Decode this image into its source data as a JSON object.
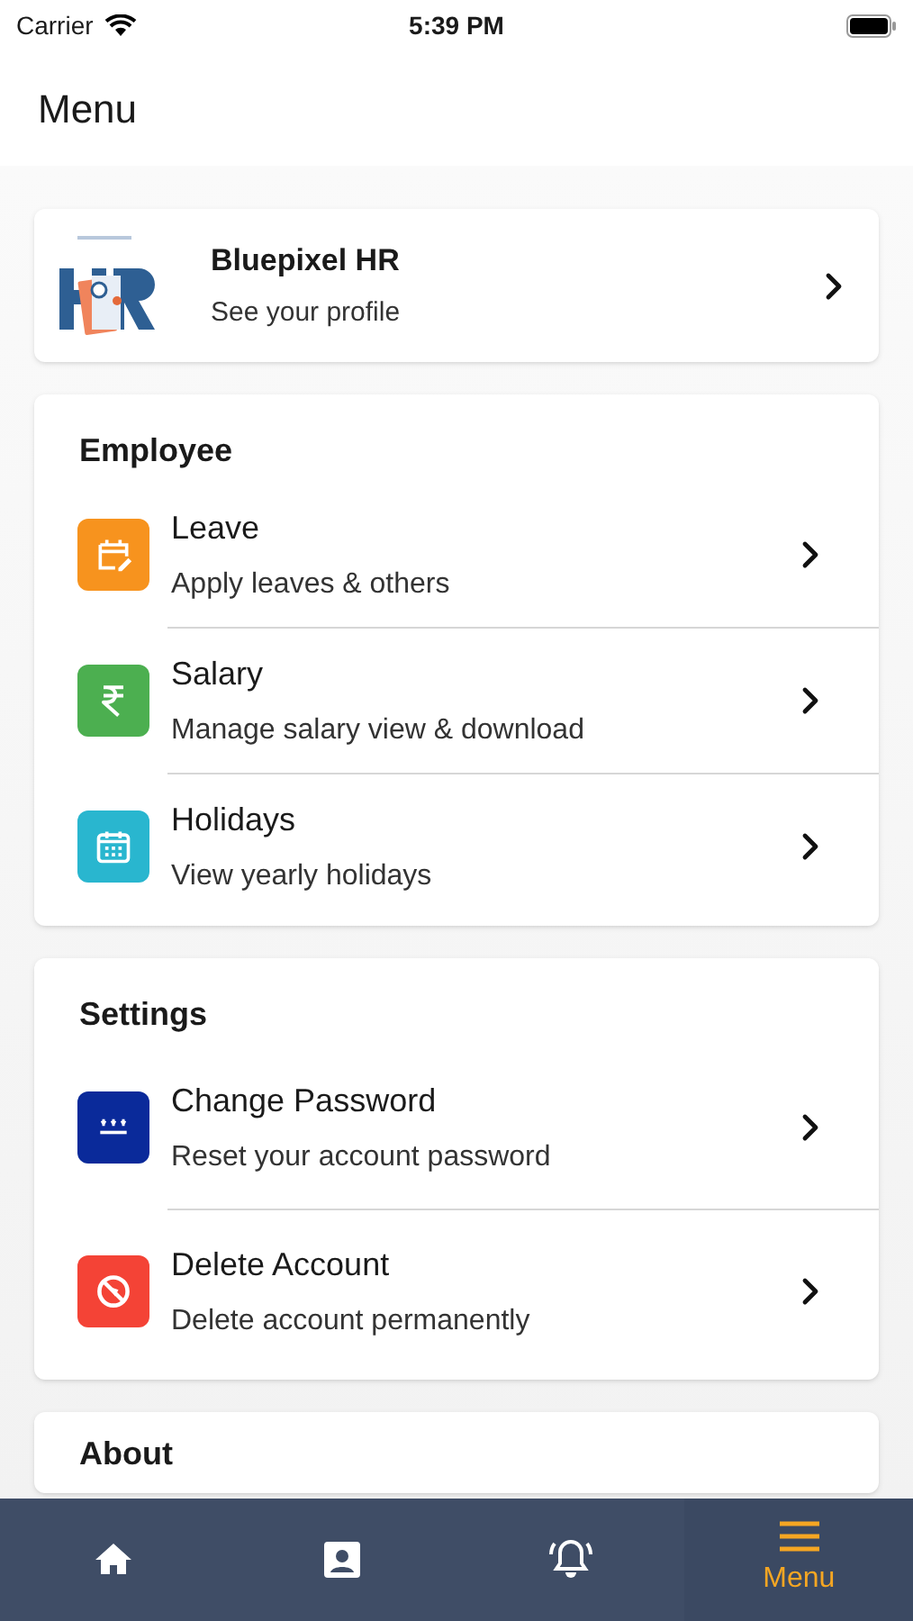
{
  "status_bar": {
    "carrier": "Carrier",
    "time": "5:39 PM"
  },
  "title": "Menu",
  "profile": {
    "name": "Bluepixel HR",
    "subtitle": "See your profile"
  },
  "sections": [
    {
      "heading": "Employee",
      "items": [
        {
          "kind": "leave",
          "title": "Leave",
          "subtitle": "Apply leaves & others",
          "color": "#f7931e"
        },
        {
          "kind": "salary",
          "title": "Salary",
          "subtitle": "Manage salary view & download",
          "color": "#4caf50"
        },
        {
          "kind": "holidays",
          "title": "Holidays",
          "subtitle": "View yearly holidays",
          "color": "#29b6cf"
        }
      ]
    },
    {
      "heading": "Settings",
      "items": [
        {
          "kind": "password",
          "title": "Change Password",
          "subtitle": "Reset your account password",
          "color": "#0a2a9a"
        },
        {
          "kind": "delete",
          "title": "Delete Account",
          "subtitle": "Delete account permanently",
          "color": "#f44336"
        }
      ]
    },
    {
      "heading": "About"
    }
  ],
  "tabs": [
    {
      "kind": "home",
      "selected": false
    },
    {
      "kind": "profile",
      "selected": false
    },
    {
      "kind": "alerts",
      "selected": false
    },
    {
      "kind": "menu",
      "label": "Menu",
      "selected": true
    }
  ]
}
